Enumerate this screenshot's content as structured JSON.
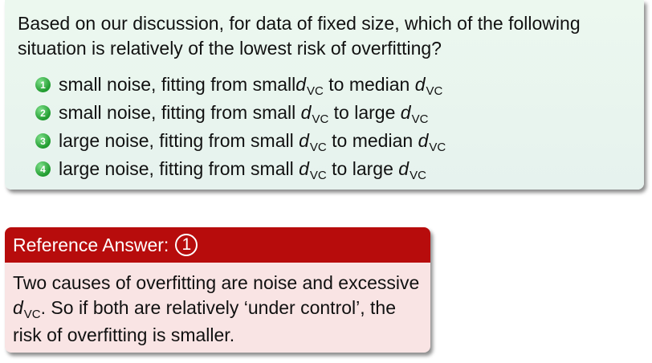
{
  "question": {
    "text": "Based on our discussion, for data of fixed size, which of the following situation is relatively of the lowest risk of overfitting?",
    "options": [
      {
        "num": "1",
        "pre": "small noise, fitting from small ",
        "mid": " to median "
      },
      {
        "num": "2",
        "pre": "small noise, fitting from small ",
        "mid": " to large "
      },
      {
        "num": "3",
        "pre": "large noise, fitting from small ",
        "mid": " to median "
      },
      {
        "num": "4",
        "pre": "large noise, fitting from small ",
        "mid": " to large "
      }
    ],
    "var_symbol": "d",
    "var_subscript": "VC"
  },
  "answer": {
    "header": "Reference Answer:",
    "choice": "1",
    "text_pre": "Two causes of overfitting are noise and excessive ",
    "text_post": ". So if both are relatively ‘under control’, the risk of overfitting is smaller."
  }
}
